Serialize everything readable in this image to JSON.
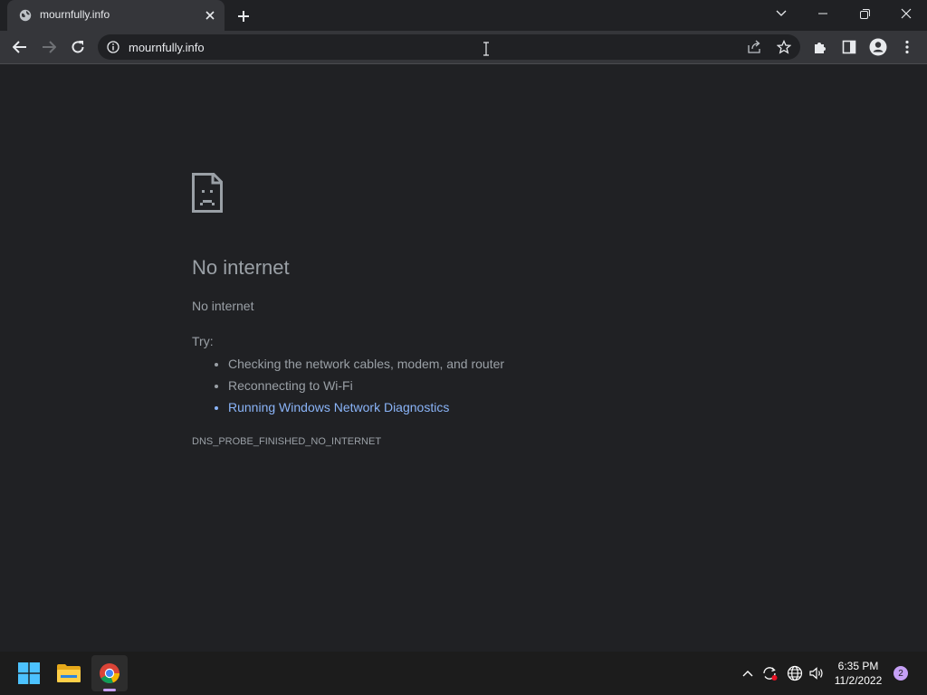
{
  "browser": {
    "tab": {
      "title": "mournfully.info",
      "close_icon": "close-icon",
      "favicon": "globe-icon"
    },
    "new_tab_icon": "plus-icon",
    "window_controls": {
      "tab_search": "chevron-down-icon",
      "minimize": "minimize-icon",
      "restore": "restore-icon",
      "close": "close-icon"
    },
    "toolbar": {
      "back": "arrow-left-icon",
      "forward": "arrow-right-icon",
      "reload": "reload-icon",
      "url": "mournfully.info",
      "site_info": "info-icon",
      "share": "share-icon",
      "bookmark": "star-icon",
      "extensions": "puzzle-icon",
      "side_panel": "side-panel-icon",
      "profile": "person-icon",
      "menu": "kebab-menu-icon"
    }
  },
  "error_page": {
    "icon": "sad-page-icon",
    "title": "No internet",
    "subtitle": "No internet",
    "try_label": "Try:",
    "suggestions": [
      "Checking the network cables, modem, and router",
      "Reconnecting to Wi-Fi",
      "Running Windows Network Diagnostics"
    ],
    "error_code": "DNS_PROBE_FINISHED_NO_INTERNET"
  },
  "taskbar": {
    "apps": [
      "windows-start-icon",
      "file-explorer-icon",
      "chrome-icon"
    ],
    "tray_icons": [
      "chevron-up-icon",
      "sync-alert-icon",
      "globe-network-icon",
      "speaker-icon"
    ],
    "time": "6:35 PM",
    "date": "11/2/2022",
    "notification_count": "2"
  },
  "colors": {
    "background": "#202124",
    "toolbar": "#35363a",
    "link": "#8ab4f8",
    "text": "#9aa0a6"
  }
}
